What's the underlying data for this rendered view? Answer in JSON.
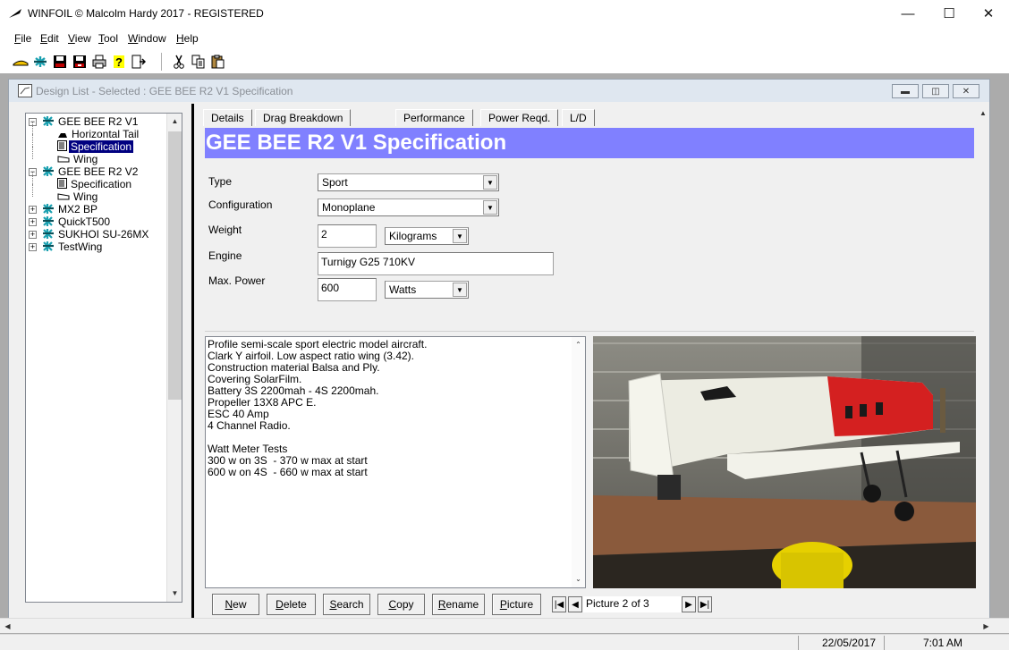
{
  "app": {
    "title": "WINFOIL © Malcolm Hardy 2017 - REGISTERED",
    "window_buttons": {
      "minimize": "—",
      "maximize": "☐",
      "close": "✕"
    }
  },
  "menu": [
    {
      "label": "File",
      "key": "F",
      "rest": "ile"
    },
    {
      "label": "Edit",
      "key": "E",
      "rest": "dit"
    },
    {
      "label": "View",
      "key": "V",
      "rest": "iew"
    },
    {
      "label": "Tool",
      "key": "T",
      "rest": "ool"
    },
    {
      "label": "Window",
      "key": "W",
      "rest": "indow"
    },
    {
      "label": "Help",
      "key": "H",
      "rest": "elp"
    }
  ],
  "toolbar": {
    "icons": [
      "wing-icon",
      "aircraft-icon",
      "save-icon",
      "save-as-icon",
      "print-icon",
      "help-icon",
      "export-icon",
      "cut-icon",
      "copy-icon",
      "paste-icon"
    ]
  },
  "child_window": {
    "title": "Design List - Selected : GEE BEE R2 V1 Specification"
  },
  "tree": [
    {
      "label": "GEE BEE R2 V1",
      "level": 0,
      "expanded": true,
      "icon": "aircraft-icon"
    },
    {
      "label": "Horizontal Tail",
      "level": 1,
      "icon": "tail-icon"
    },
    {
      "label": "Specification",
      "level": 1,
      "icon": "document-icon",
      "selected": true
    },
    {
      "label": "Wing",
      "level": 1,
      "icon": "wing-icon"
    },
    {
      "label": "GEE BEE R2 V2",
      "level": 0,
      "expanded": true,
      "icon": "aircraft-icon"
    },
    {
      "label": "Specification",
      "level": 1,
      "icon": "document-icon"
    },
    {
      "label": "Wing",
      "level": 1,
      "icon": "wing-icon"
    },
    {
      "label": "MX2 BP",
      "level": 0,
      "expanded": false,
      "icon": "aircraft-icon"
    },
    {
      "label": "QuickT500",
      "level": 0,
      "expanded": false,
      "icon": "aircraft-icon"
    },
    {
      "label": "SUKHOI SU-26MX",
      "level": 0,
      "expanded": false,
      "icon": "aircraft-icon"
    },
    {
      "label": "TestWing",
      "level": 0,
      "expanded": false,
      "icon": "aircraft-icon"
    }
  ],
  "tabs": [
    "Details",
    "Drag Breakdown",
    "Performance",
    "Power Reqd.",
    "L/D"
  ],
  "active_tab": "Details",
  "header": "GEE BEE R2 V1 Specification",
  "form": {
    "type_label": "Type",
    "type_value": "Sport",
    "config_label": "Configuration",
    "config_value": "Monoplane",
    "weight_label": "Weight",
    "weight_value": "2",
    "weight_unit": "Kilograms",
    "engine_label": "Engine",
    "engine_value": "Turnigy G25 710KV",
    "power_label": "Max. Power",
    "power_value": "600",
    "power_unit": "Watts"
  },
  "notes": "Profile semi-scale sport electric model aircraft.\nClark Y airfoil. Low aspect ratio wing (3.42).\nConstruction material Balsa and Ply.\nCovering SolarFilm.\nBattery 3S 2200mah - 4S 2200mah.\nPropeller 13X8 APC E.\nESC 40 Amp\n4 Channel Radio.\n\nWatt Meter Tests\n300 w on 3S  - 370 w max at start\n600 w on 4S  - 660 w max at start",
  "buttons": [
    {
      "label": "New",
      "key": "N",
      "rest": "ew"
    },
    {
      "label": "Delete",
      "key": "D",
      "rest": "elete"
    },
    {
      "label": "Search",
      "key": "S",
      "rest": "earch"
    },
    {
      "label": "Copy",
      "key": "C",
      "rest": "opy"
    },
    {
      "label": "Rename",
      "key": "R",
      "rest": "ename"
    },
    {
      "label": "Picture",
      "key": "P",
      "rest": "icture"
    }
  ],
  "picture_nav": {
    "text": "Picture 2 of 3"
  },
  "status": {
    "date": "22/05/2017",
    "time": "7:01 AM"
  },
  "colors": {
    "header_band": "#8080ff",
    "selection": "#000080",
    "fuselage_red": "#d42020"
  }
}
